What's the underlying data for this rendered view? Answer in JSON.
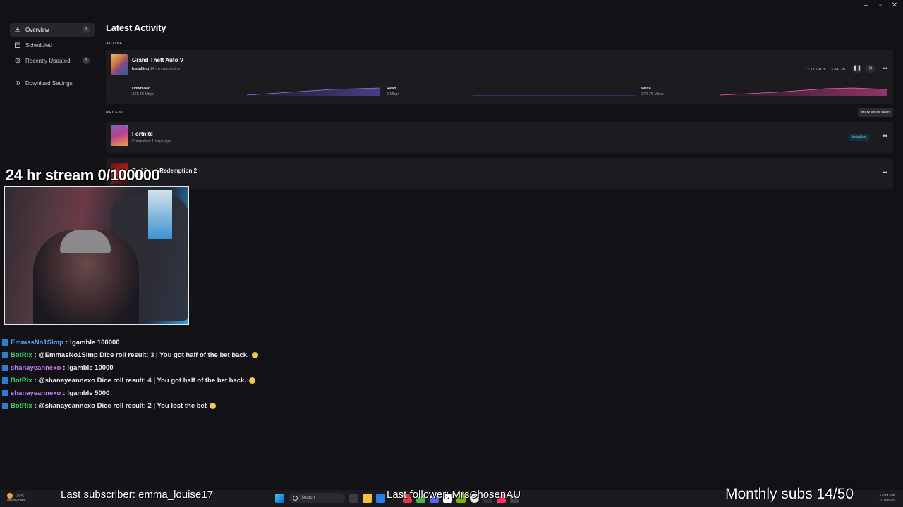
{
  "window": {
    "minimize": "–",
    "maximize": "▫",
    "close": "✕"
  },
  "sidebar": {
    "items": [
      {
        "label": "Overview",
        "badge": "1"
      },
      {
        "label": "Scheduled",
        "badge": ""
      },
      {
        "label": "Recently Updated",
        "badge": "1"
      },
      {
        "label": "Download Settings",
        "badge": ""
      }
    ]
  },
  "main": {
    "title": "Latest Activity",
    "active_label": "ACTIVE",
    "recent_label": "RECENT",
    "mark_all_label": "Mark all as seen",
    "active": {
      "title": "Grand Theft Auto V",
      "status": "Installing",
      "remaining": "14 min remaining",
      "size": "77.77 GB of 113.84 GB",
      "progress": 0.68,
      "stats": [
        {
          "label": "Download",
          "value": "331.48 Mbps"
        },
        {
          "label": "Read",
          "value": "0 Mbps"
        },
        {
          "label": "Write",
          "value": "370.76 Mbps"
        }
      ]
    },
    "recent": [
      {
        "title": "Fortnite",
        "sub": "Completed 1 days ago",
        "status": "Installed"
      },
      {
        "title": "Red Dead Redemption 2",
        "sub": "",
        "status": ""
      }
    ]
  },
  "overlay": {
    "stream_title": "24 hr stream 0/100000",
    "last_subscriber": "Last subscriber: emma_louise17",
    "last_follower": "Last follower: MrsChosenAU",
    "monthly_subs": "Monthly subs 14/50"
  },
  "chat": [
    {
      "user": "EmmasNo1Simp",
      "color": "#5aa9ff",
      "msg": ": !gamble 100000",
      "emoji": false
    },
    {
      "user": "BotRix",
      "color": "#3fd56a",
      "msg": ": @EmmasNo1Simp Dice roll result: 3 | You got half of the bet back.",
      "emoji": true
    },
    {
      "user": "shanayeannexo",
      "color": "#c77dff",
      "msg": ": !gamble 10000",
      "emoji": false
    },
    {
      "user": "BotRix",
      "color": "#3fd56a",
      "msg": ": @shanayeannexo Dice roll result: 4 | You got half of the bet back.",
      "emoji": true
    },
    {
      "user": "shanayeannexo",
      "color": "#c77dff",
      "msg": ": !gamble 5000",
      "emoji": false
    },
    {
      "user": "BotRix",
      "color": "#3fd56a",
      "msg": ": @shanayeannexo Dice roll result: 2 | You lost the bet",
      "emoji": true
    }
  ],
  "taskbar": {
    "weather_temp": "25°C",
    "weather_desc": "Mostly clear",
    "search_placeholder": "Search",
    "time": "12:09 PM",
    "date": "11/10/2025"
  },
  "colors": {
    "accent": "#27a8e0",
    "download_graph": "#6b5bd6",
    "write_graph": "#e0459a"
  }
}
